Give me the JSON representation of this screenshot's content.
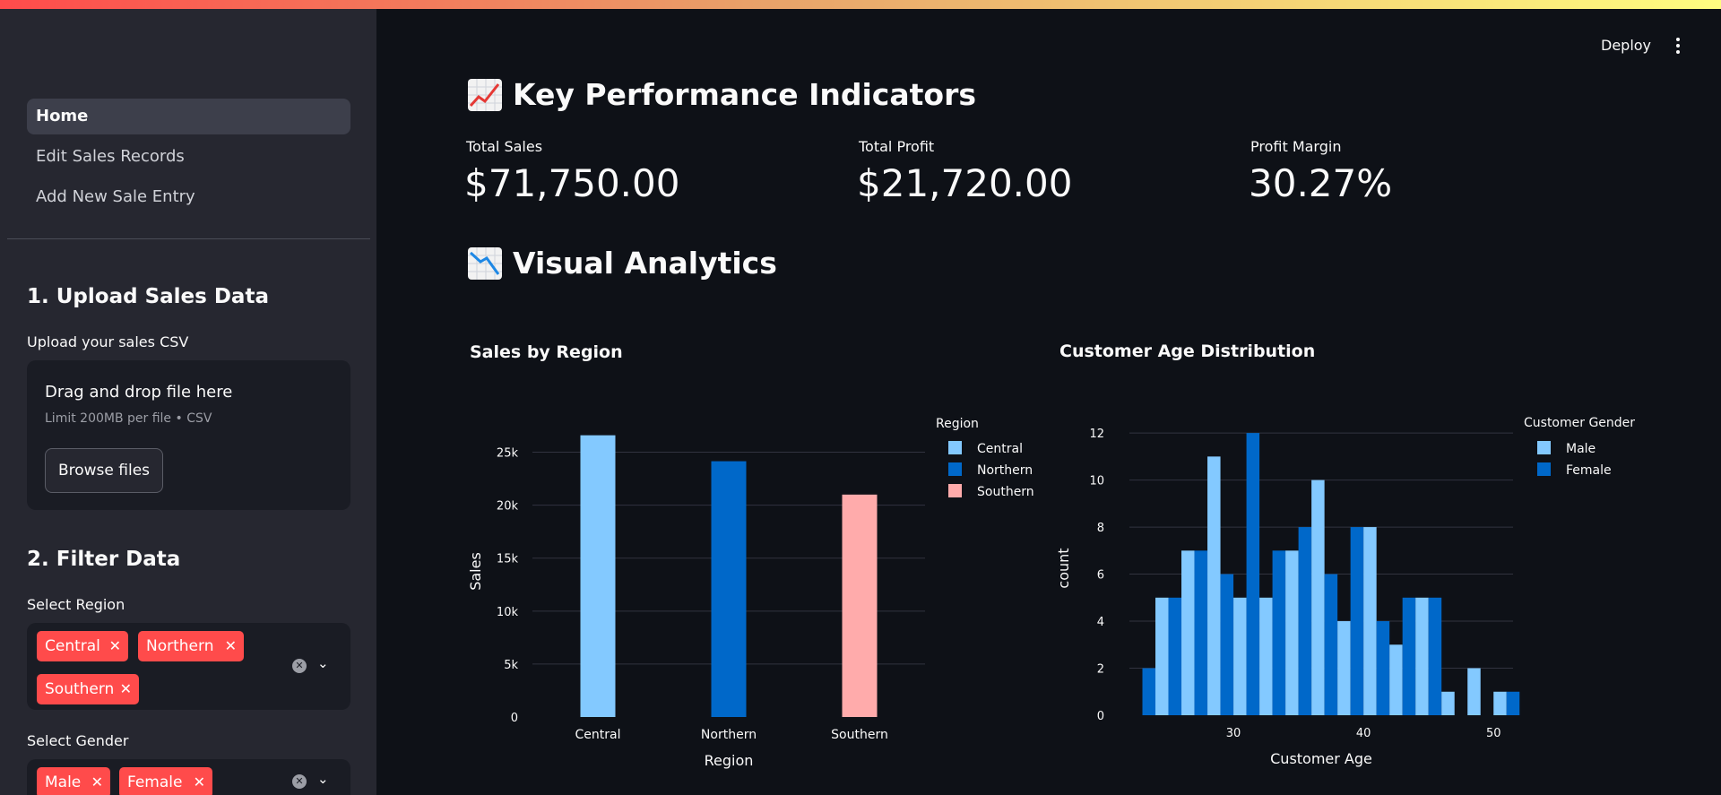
{
  "sidebar": {
    "nav": [
      "Home",
      "Edit Sales Records",
      "Add New Sale Entry"
    ],
    "upload": {
      "heading": "1. Upload Sales Data",
      "label": "Upload your sales CSV",
      "drop_text": "Drag and drop file here",
      "limit_text": "Limit 200MB per file • CSV",
      "browse_label": "Browse files"
    },
    "filter": {
      "heading": "2. Filter Data",
      "region_label": "Select Region",
      "region_chips": [
        "Central",
        "Northern",
        "Southern"
      ],
      "gender_label": "Select Gender",
      "gender_chips": [
        "Male",
        "Female"
      ]
    }
  },
  "header": {
    "deploy_label": "Deploy"
  },
  "kpi": {
    "heading": "Key Performance Indicators",
    "icon": "chart-increasing-icon",
    "metrics": [
      {
        "label": "Total Sales",
        "value": "$71,750.00"
      },
      {
        "label": "Total Profit",
        "value": "$21,720.00"
      },
      {
        "label": "Profit Margin",
        "value": "30.27%"
      }
    ]
  },
  "analytics": {
    "heading": "Visual Analytics",
    "icon": "chart-decreasing-icon"
  },
  "colors": {
    "accent": "#ff4b4b",
    "light_blue": "#83c9ff",
    "blue": "#0068c9",
    "pink": "#ffabab"
  },
  "chart_data": [
    {
      "type": "bar",
      "title": "Sales by Region",
      "xlabel": "Region",
      "ylabel": "Sales",
      "categories": [
        "Central",
        "Northern",
        "Southern"
      ],
      "values": [
        26600,
        24150,
        21000
      ],
      "ylim": [
        0,
        27500
      ],
      "yticks": [
        "0",
        "5k",
        "10k",
        "15k",
        "20k",
        "25k"
      ],
      "legend_title": "Region",
      "legend": [
        "Central",
        "Northern",
        "Southern"
      ],
      "colors": [
        "#83c9ff",
        "#0068c9",
        "#ffabab"
      ],
      "grid": true,
      "legend_position": "right"
    },
    {
      "type": "bar",
      "title": "Customer Age Distribution",
      "xlabel": "Customer Age",
      "ylabel": "count",
      "xticks": [
        "30",
        "40",
        "50"
      ],
      "yticks": [
        "0",
        "2",
        "4",
        "6",
        "8",
        "10",
        "12"
      ],
      "ylim": [
        0,
        12.5
      ],
      "legend_title": "Customer Gender",
      "legend_position": "right",
      "grid": true,
      "bins": [
        {
          "x": 23,
          "female": 2
        },
        {
          "x": 24,
          "male": 5,
          "female": 5
        },
        {
          "x": 26,
          "male": 7,
          "female": 7
        },
        {
          "x": 28,
          "male": 11,
          "female": 6
        },
        {
          "x": 30,
          "male": 5,
          "female": 12
        },
        {
          "x": 32,
          "male": 5,
          "female": 7
        },
        {
          "x": 34,
          "male": 7,
          "female": 8
        },
        {
          "x": 36,
          "male": 10,
          "female": 6
        },
        {
          "x": 38,
          "male": 4,
          "female": 8
        },
        {
          "x": 40,
          "male": 8,
          "female": 4
        },
        {
          "x": 42,
          "male": 3,
          "female": 5
        },
        {
          "x": 44,
          "male": 5,
          "female": 5
        },
        {
          "x": 46,
          "male": 1
        },
        {
          "x": 48,
          "male": 2
        },
        {
          "x": 50,
          "male": 1,
          "female": 1
        }
      ],
      "series": [
        {
          "name": "Male",
          "color": "#83c9ff"
        },
        {
          "name": "Female",
          "color": "#0068c9"
        }
      ]
    }
  ]
}
